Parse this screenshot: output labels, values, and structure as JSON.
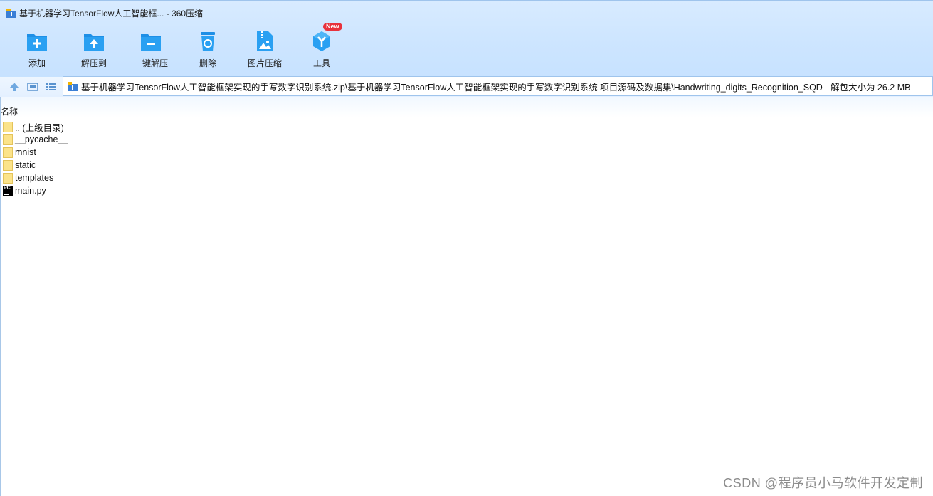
{
  "window": {
    "title": "基于机器学习TensorFlow人工智能框... - 360压缩"
  },
  "toolbar": {
    "items": [
      {
        "label": "添加",
        "icon": "folder-add-icon"
      },
      {
        "label": "解压到",
        "icon": "folder-extract-icon"
      },
      {
        "label": "一键解压",
        "icon": "folder-quick-extract-icon"
      },
      {
        "label": "删除",
        "icon": "recycle-bin-icon"
      },
      {
        "label": "图片压缩",
        "icon": "image-compress-icon"
      },
      {
        "label": "工具",
        "icon": "tools-icon",
        "badge": "New"
      }
    ]
  },
  "nav": {
    "address": "基于机器学习TensorFlow人工智能框架实现的手写数字识别系统.zip\\基于机器学习TensorFlow人工智能框架实现的手写数字识别系统 项目源码及数据集\\Handwriting_digits_Recognition_SQD - 解包大小为 26.2 MB"
  },
  "file_list": {
    "column_name": "名称",
    "items": [
      {
        "name": ".. (上级目录)",
        "type": "folder"
      },
      {
        "name": "__pycache__",
        "type": "folder"
      },
      {
        "name": "mnist",
        "type": "folder"
      },
      {
        "name": "static",
        "type": "folder"
      },
      {
        "name": "templates",
        "type": "folder"
      },
      {
        "name": "main.py",
        "type": "pycharm-file"
      }
    ]
  },
  "watermark": "CSDN @程序员小马软件开发定制",
  "colors": {
    "header_bg": "#cde5ff",
    "accent_blue": "#1e90e8",
    "badge_red": "#e8323c",
    "folder_yellow": "#fbe38a"
  }
}
